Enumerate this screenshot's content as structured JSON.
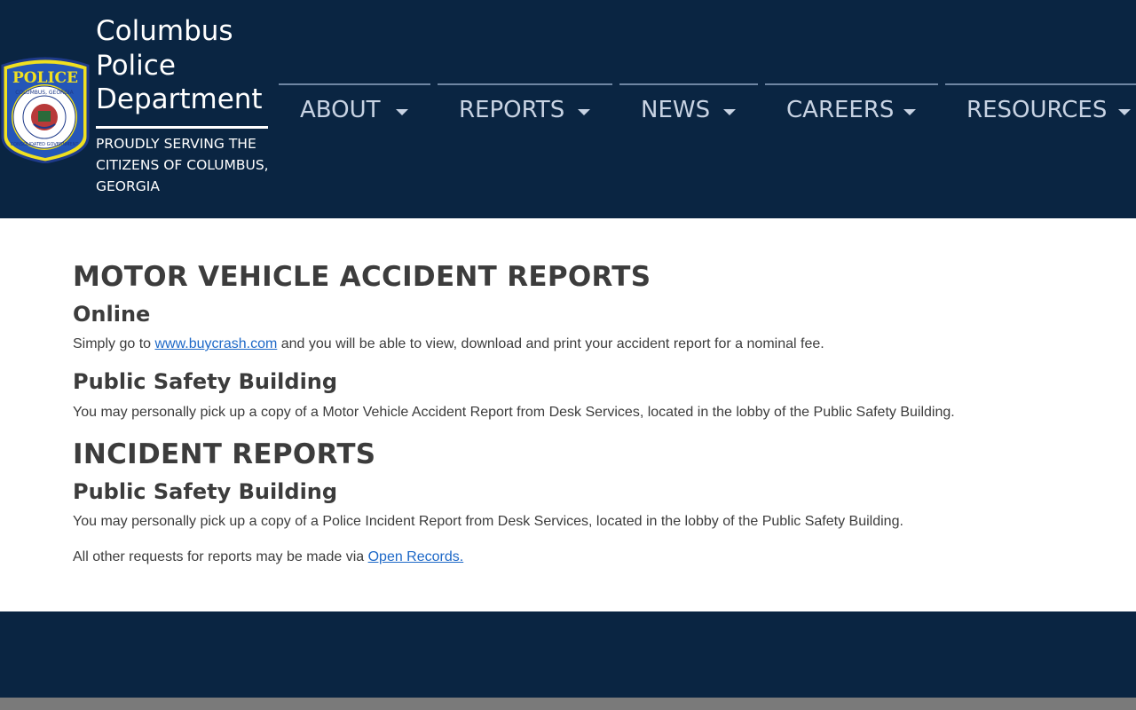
{
  "header": {
    "title": "Columbus Police Department",
    "tagline": "PROUDLY SERVING THE CITIZENS OF COLUMBUS, GEORGIA",
    "badge": {
      "top_text": "POLICE",
      "ring_text": "COLUMBUS, GEORGIA",
      "bottom_text": "CONSOLIDATED GOVERNMENT"
    }
  },
  "nav": {
    "items": [
      {
        "label": "ABOUT"
      },
      {
        "label": "REPORTS"
      },
      {
        "label": "NEWS"
      },
      {
        "label": "CAREERS"
      },
      {
        "label": "RESOURCES"
      }
    ]
  },
  "content": {
    "mva_heading": "MOTOR VEHICLE ACCIDENT REPORTS",
    "online_heading": "Online",
    "online_text_before": "Simply go to ",
    "online_link": "www.buycrash.com",
    "online_text_after": " and you will be able to view, download and print your accident report for a nominal fee.",
    "psb_heading_1": "Public Safety Building",
    "psb_text_1": "You may personally pick up a copy of a Motor Vehicle Accident Report from Desk Services, located in the lobby of the Public Safety Building.",
    "incident_heading": "INCIDENT REPORTS",
    "psb_heading_2": "Public Safety Building",
    "psb_text_2": "You may personally pick up a copy of a Police Incident Report from Desk Services, located in the lobby of the Public Safety Building.",
    "other_text": "All other requests for reports may be made via ",
    "open_records_link": "Open Records."
  },
  "colors": {
    "header_bg": "#0a2542",
    "nav_text": "#c8d3e3",
    "body_text": "#3c3c3c",
    "link": "#1d68c7",
    "footer_bottom": "#7a7a7a"
  }
}
